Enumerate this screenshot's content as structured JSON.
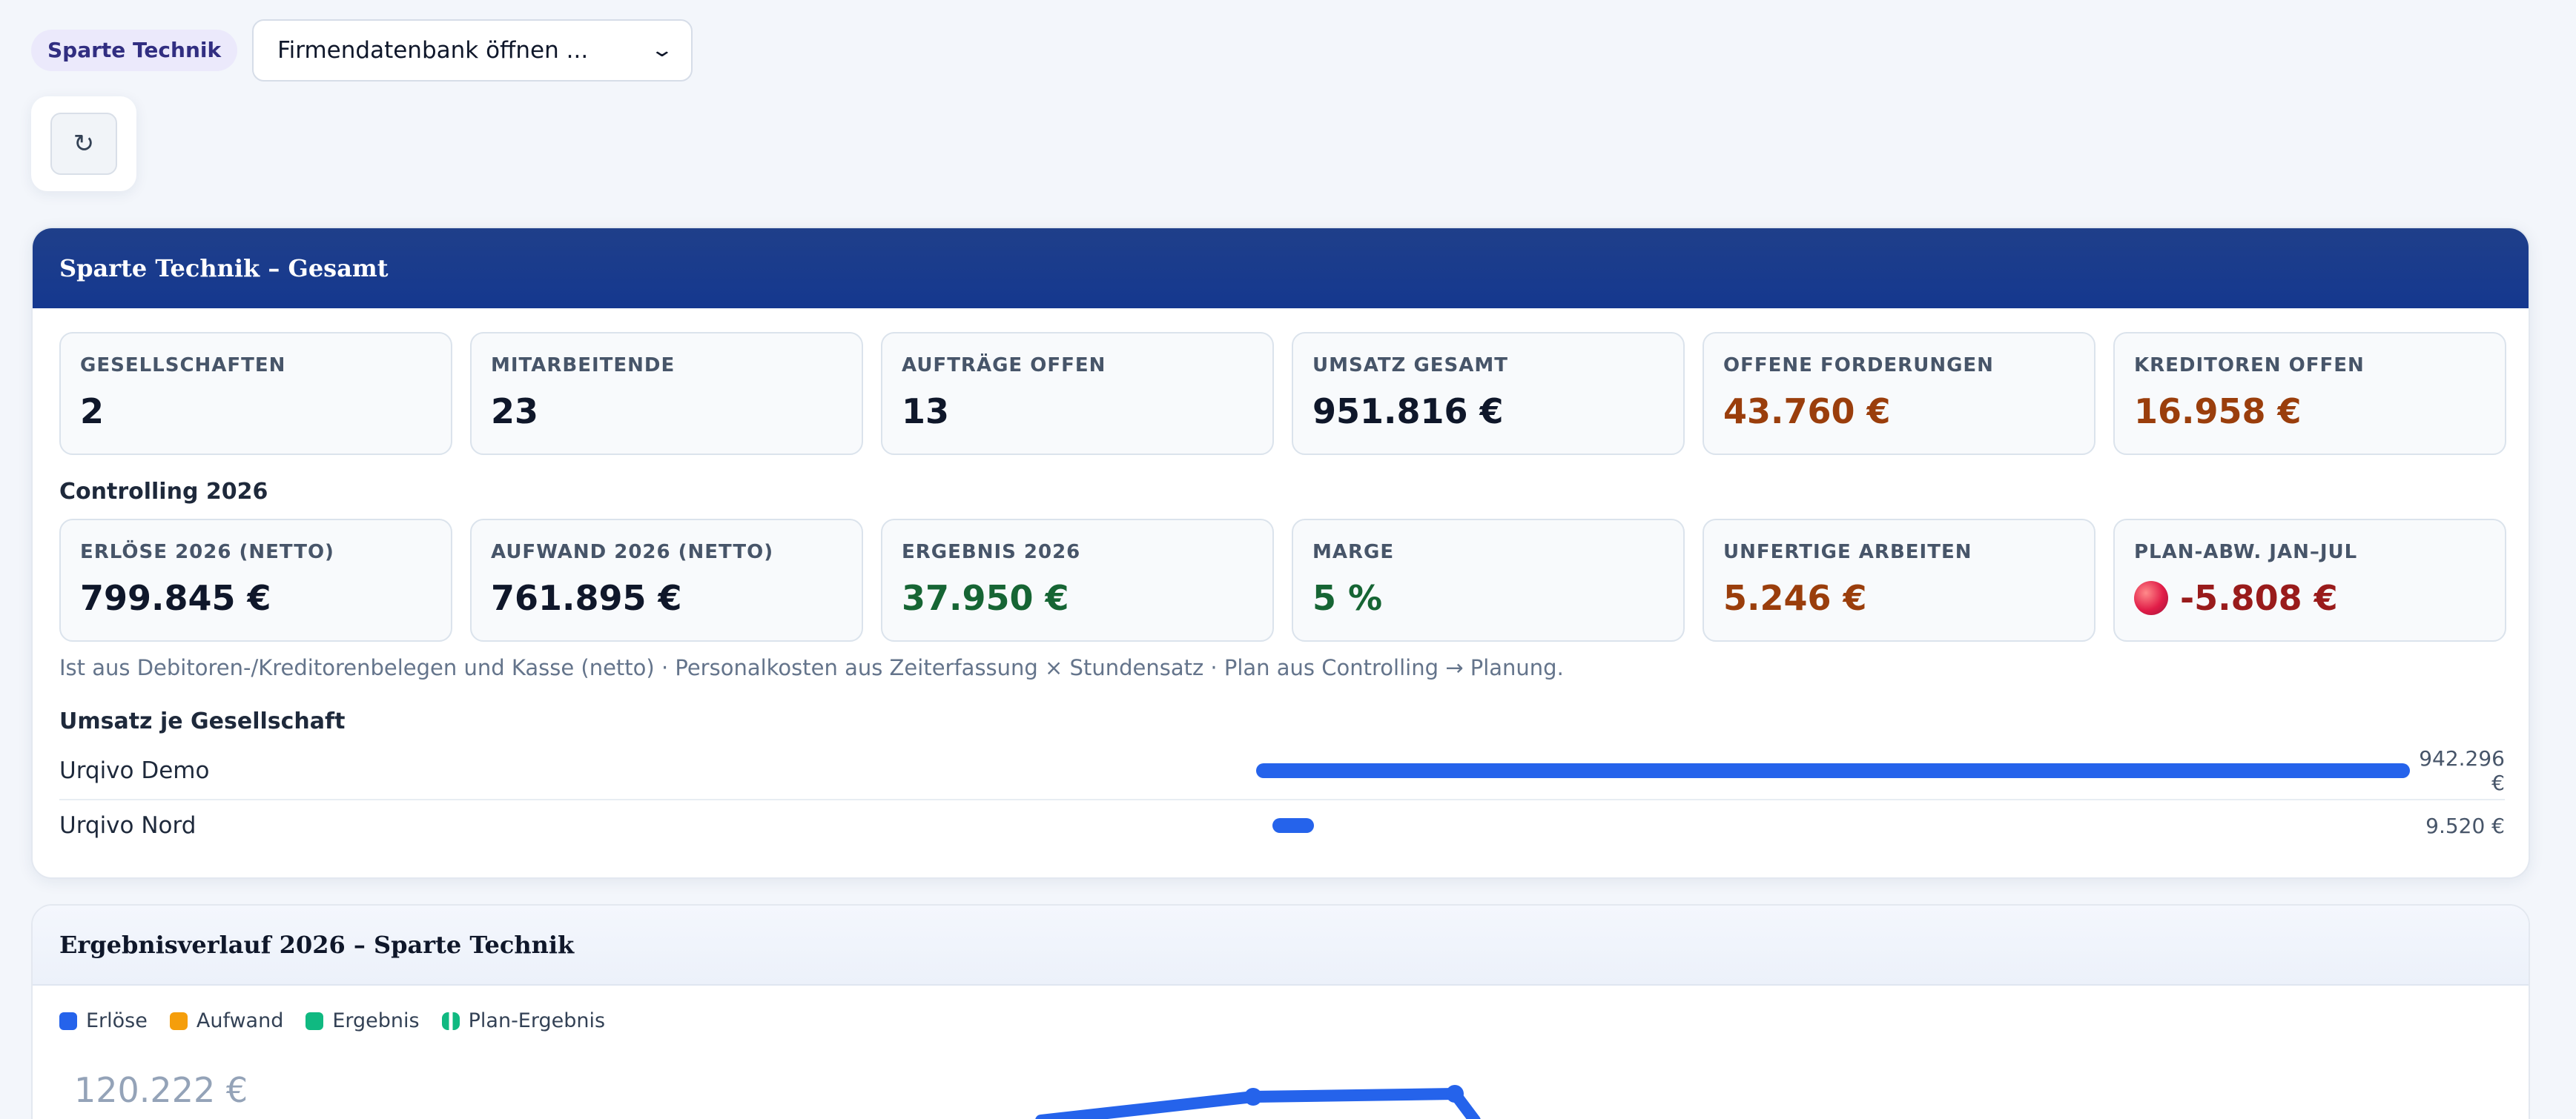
{
  "topbar": {
    "sparte_label": "Sparte Technik",
    "db_select_value": "Firmendatenbank öffnen ...",
    "refresh_glyph": "↻"
  },
  "panel": {
    "title": "Sparte Technik – Gesamt",
    "kpis_row1": [
      {
        "label": "GESELLSCHAFTEN",
        "value": "2"
      },
      {
        "label": "MITARBEITENDE",
        "value": "23"
      },
      {
        "label": "AUFTRÄGE OFFEN",
        "value": "13"
      },
      {
        "label": "UMSATZ GESAMT",
        "value": "951.816 €"
      },
      {
        "label": "OFFENE FORDERUNGEN",
        "value": "43.760 €"
      },
      {
        "label": "KREDITOREN OFFEN",
        "value": "16.958 €"
      }
    ],
    "controlling_title": "Controlling 2026",
    "kpis_row2": [
      {
        "label": "ERLÖSE 2026 (NETTO)",
        "value": "799.845 €"
      },
      {
        "label": "AUFWAND 2026 (NETTO)",
        "value": "761.895 €"
      },
      {
        "label": "ERGEBNIS 2026",
        "value": "37.950 €"
      },
      {
        "label": "MARGE",
        "value": "5 %"
      },
      {
        "label": "UNFERTIGE ARBEITEN",
        "value": "5.246 €"
      },
      {
        "label": "PLAN-ABW. JAN–JUL",
        "value": "-5.808 €"
      }
    ],
    "note": "Ist aus Debitoren-/Kreditorenbelegen und Kasse (netto) · Personalkosten aus Zeiterfassung × Stundensatz · Plan aus Controlling → Planung.",
    "umsatz_title": "Umsatz je Gesellschaft",
    "umsatz_rows": [
      {
        "name": "Urqivo Demo",
        "amount": "942.296 €",
        "share": 0.99
      },
      {
        "name": "Urqivo Nord",
        "amount": "9.520 €",
        "share": 0.01
      }
    ]
  },
  "chart_panel": {
    "title": "Ergebnisverlauf 2026 – Sparte Technik",
    "legend": [
      "Erlöse",
      "Aufwand",
      "Ergebnis",
      "Plan-Ergebnis"
    ],
    "y_top_tick": "120.222 €"
  },
  "colors": {
    "erloese": "#2563eb",
    "aufwand": "#f59e0b",
    "ergebnis": "#10b981",
    "plan_ergebnis": "#10b981"
  },
  "chart_data": {
    "type": "line",
    "title": "Ergebnisverlauf 2026 – Sparte Technik",
    "legend": [
      "Erlöse",
      "Aufwand",
      "Ergebnis",
      "Plan-Ergebnis"
    ],
    "y_tick_visible": "120.222 €",
    "series": [
      {
        "name": "Erlöse",
        "partial_visible": true
      }
    ]
  }
}
